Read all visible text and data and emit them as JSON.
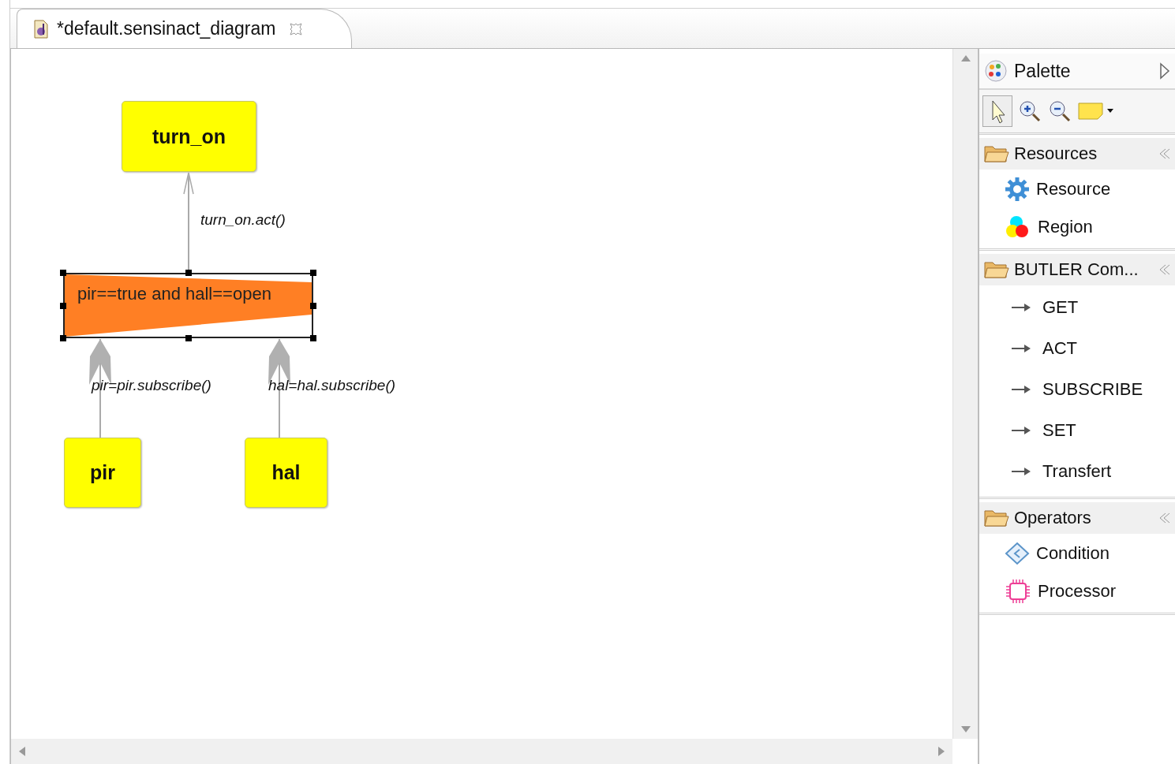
{
  "editor_tab": {
    "title": "*default.sensinact_diagram"
  },
  "diagram": {
    "nodes": [
      {
        "kind": "resource",
        "label": "turn_on",
        "selected": false
      },
      {
        "kind": "condition",
        "label": "pir==true and hall==open",
        "selected": true
      },
      {
        "kind": "resource",
        "label": "pir",
        "selected": false
      },
      {
        "kind": "resource",
        "label": "hal",
        "selected": false
      }
    ],
    "edges": [
      {
        "kind": "plain",
        "label": "turn_on.act()"
      },
      {
        "kind": "heavy",
        "label": "pir=pir.subscribe()"
      },
      {
        "kind": "heavy",
        "label": "hal=hal.subscribe()"
      }
    ]
  },
  "palette": {
    "title": "Palette",
    "drawers": [
      {
        "label": "Resources",
        "expanded": true,
        "items": [
          {
            "kind": "gear",
            "label": "Resource"
          },
          {
            "kind": "region",
            "label": "Region"
          }
        ]
      },
      {
        "label": "BUTLER Com...",
        "expanded": true,
        "items": [
          {
            "kind": "arrow",
            "label": "GET"
          },
          {
            "kind": "arrow",
            "label": "ACT"
          },
          {
            "kind": "arrow",
            "label": "SUBSCRIBE"
          },
          {
            "kind": "arrow",
            "label": "SET"
          },
          {
            "kind": "arrow",
            "label": "Transfert"
          }
        ]
      },
      {
        "label": "Operators",
        "expanded": true,
        "items": [
          {
            "kind": "condition",
            "label": "Condition"
          },
          {
            "kind": "processor",
            "label": "Processor"
          }
        ]
      }
    ]
  }
}
